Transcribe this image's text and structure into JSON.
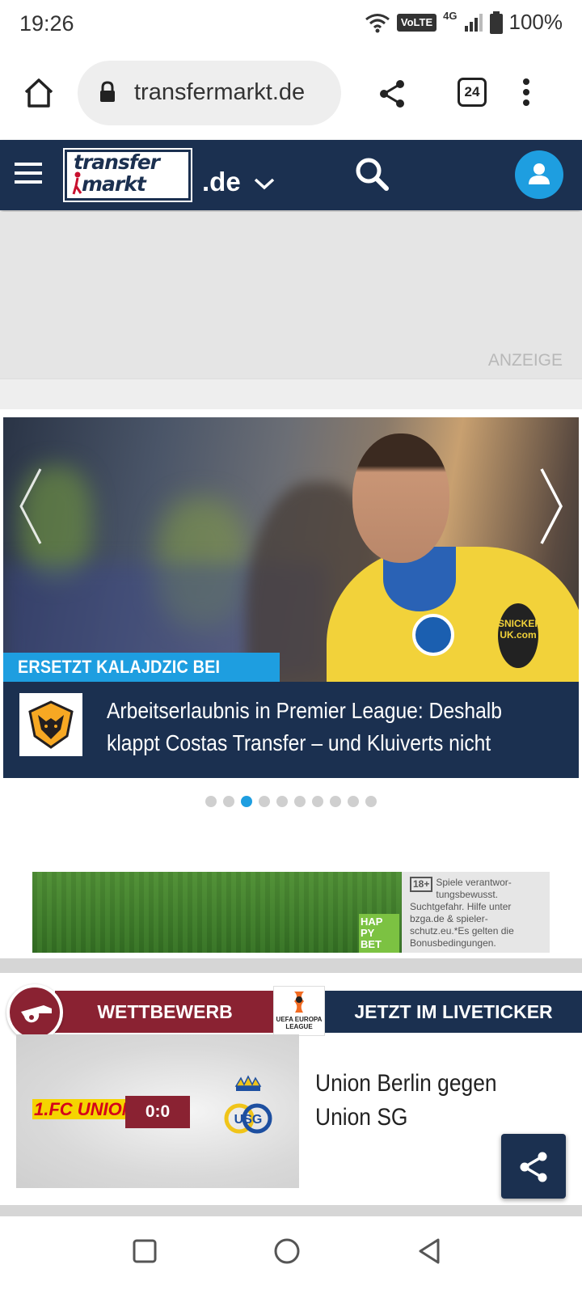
{
  "status_bar": {
    "time": "19:26",
    "volte": "VoLTE",
    "network": "4G",
    "battery": "100%"
  },
  "browser": {
    "url": "transfermarkt.de",
    "tab_count": "24"
  },
  "site_header": {
    "logo_line1": "transfer",
    "logo_line2": "markt",
    "domain": ".de"
  },
  "ad_top": {
    "label": "ANZEIGE"
  },
  "hero": {
    "kicker": "ERSETZT KALAJDZIC BEI WOLVES",
    "headline": "Arbeitserlaubnis in Premier League: Deshalb klappt Costas Transfer – und Kluiverts nicht",
    "sponsor_text": "SNICKERS UK.com",
    "total_slides": 10,
    "active_slide": 3
  },
  "ad_banner": {
    "brand": "HAP PY BET",
    "age_badge": "18+",
    "disclaimer": "Spiele verantwor-tungsbewusst. Suchtgefahr. Hilfe unter bzga.de & spieler-schutz.eu.*Es gelten die Bonusbedingungen."
  },
  "match_card": {
    "competition_label": "WETTBEWERB",
    "live_label": "JETZT IM LIVETICKER",
    "competition_badge": "UEFA EUROPA LEAGUE",
    "home_team_logo_text": "1.FC UNION",
    "score": "0:0",
    "away_team_logo_text": "USG",
    "title": "Union Berlin gegen Union SG"
  },
  "colors": {
    "navy": "#1b3050",
    "accent_blue": "#1e9ee0",
    "wine_red": "#8a2232"
  }
}
